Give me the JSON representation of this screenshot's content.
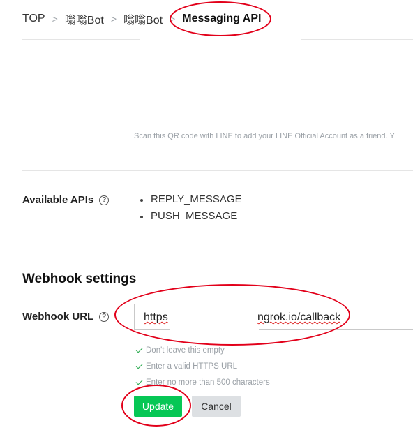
{
  "breadcrumb": {
    "items": [
      "TOP",
      "嗡嗡Bot",
      "嗡嗡Bot"
    ],
    "current": "Messaging API",
    "separator": ">"
  },
  "qr": {
    "note": "Scan this QR code with LINE to add your LINE Official Account as a friend. Y"
  },
  "available_apis": {
    "label": "Available APIs",
    "items": [
      "REPLY_MESSAGE",
      "PUSH_MESSAGE"
    ]
  },
  "webhook": {
    "section_title": "Webhook settings",
    "url_label": "Webhook URL",
    "url_value_prefix": "https",
    "url_value_suffix": "ngrok.io/callback",
    "rules": [
      "Don't leave this empty",
      "Enter a valid HTTPS URL",
      "Enter no more than 500 characters"
    ],
    "update_label": "Update",
    "cancel_label": "Cancel"
  },
  "help_glyph": "?",
  "colors": {
    "annotation": "#e2001a",
    "primary_green": "#06c755",
    "check_green": "#2aaa4f",
    "cancel_gray": "#dde0e3"
  }
}
